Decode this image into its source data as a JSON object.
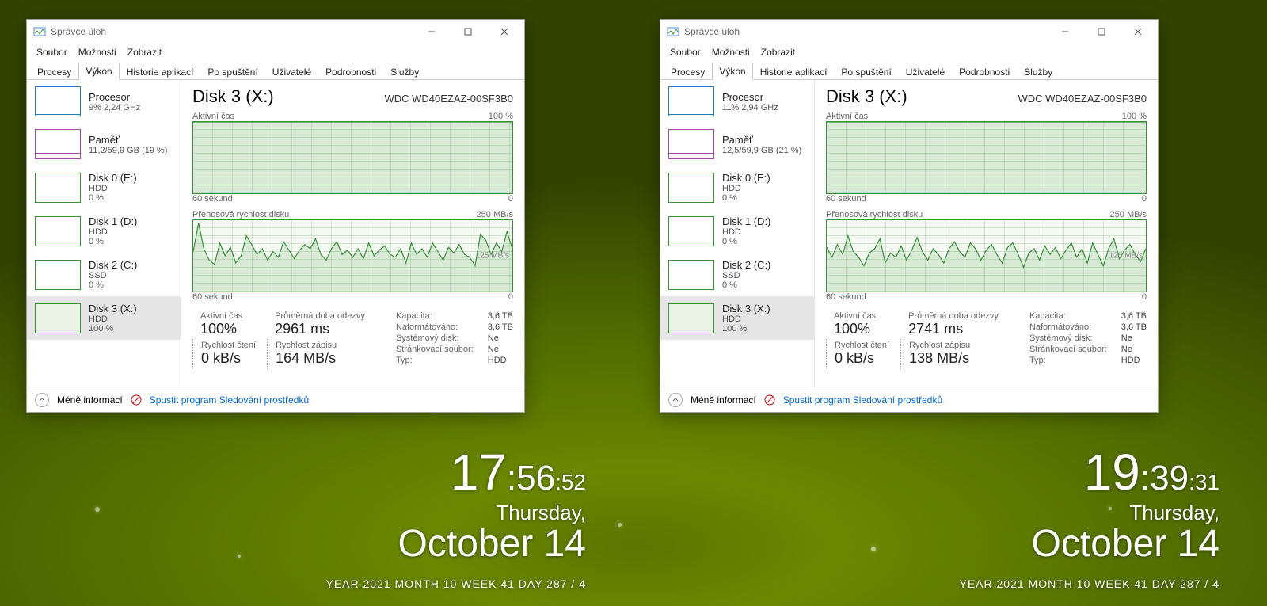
{
  "window_title": "Správce úloh",
  "menubar": [
    "Soubor",
    "Možnosti",
    "Zobrazit"
  ],
  "tabs": [
    "Procesy",
    "Výkon",
    "Historie aplikací",
    "Po spuštění",
    "Uživatelé",
    "Podrobnosti",
    "Služby"
  ],
  "selected_tab": "Výkon",
  "footer": {
    "less": "Méně informací",
    "resmon": "Spustit program Sledování prostředků"
  },
  "panel_common": {
    "disk_title": "Disk 3 (X:)",
    "disk_model": "WDC WD40EZAZ-00SF3B0",
    "g1_title": "Aktivní čas",
    "g1_max": "100 %",
    "g2_title": "Přenosová rychlost disku",
    "g2_max": "250 MB/s",
    "g2_mid": "125 MB/s",
    "x_left": "60 sekund",
    "x_right": "0",
    "lab_active": "Aktivní čas",
    "lab_resp": "Průměrná doba odezvy",
    "lab_read": "Rychlost čtení",
    "lab_write": "Rychlost zápisu",
    "props": {
      "k_cap": "Kapacita:",
      "k_fmt": "Naformátováno:",
      "k_sys": "Systémový disk:",
      "k_page": "Stránkovací soubor:",
      "k_type": "Typ:",
      "v_cap": "3,6 TB",
      "v_fmt": "3,6 TB",
      "v_sys": "Ne",
      "v_page": "Ne",
      "v_type": "HDD"
    }
  },
  "sidebar_common": {
    "cpu_title": "Procesor",
    "mem_title": "Paměť",
    "d0_title": "Disk 0 (E:)",
    "d0_sub": "HDD",
    "d0_pct": "0 %",
    "d1_title": "Disk 1 (D:)",
    "d1_sub": "HDD",
    "d1_pct": "0 %",
    "d2_title": "Disk 2 (C:)",
    "d2_sub": "SSD",
    "d2_pct": "0 %",
    "d3_title": "Disk 3 (X:)",
    "d3_sub": "HDD",
    "d3_pct": "100 %"
  },
  "panels": [
    {
      "cpu_sub": "9% 2,24 GHz",
      "mem_sub": "11,2/59,9 GB (19 %)",
      "active": "100%",
      "resp": "2961 ms",
      "read": "0 kB/s",
      "write": "164 MB/s",
      "clock": {
        "h": "17",
        "m": "56",
        "s": "52",
        "dow": "Thursday,",
        "mon": "October",
        "day": "14",
        "meta": "YEAR 2021      MONTH 10      WEEK 41      DAY 287   / 4"
      },
      "chart_data": [
        {
          "type": "line",
          "title": "Aktivní čas",
          "ylabel": "%",
          "ylim": [
            0,
            100
          ],
          "xlim_seconds": [
            60,
            0
          ],
          "values": [
            100,
            100,
            100,
            100,
            100,
            100,
            100,
            100,
            100,
            100,
            100,
            100,
            100,
            100,
            100,
            100,
            100,
            100,
            100,
            100,
            100,
            100,
            100,
            100,
            100,
            100,
            100,
            100,
            100,
            100,
            100,
            100,
            100,
            100,
            100,
            100,
            100,
            100,
            100,
            100,
            100,
            100,
            100,
            100,
            100,
            100,
            100,
            100,
            100,
            100,
            100,
            100,
            100,
            100,
            100,
            100,
            100,
            100,
            100,
            100,
            100
          ]
        },
        {
          "type": "line",
          "title": "Přenosová rychlost disku",
          "ylabel": "MB/s",
          "ylim": [
            0,
            250
          ],
          "xlim_seconds": [
            60,
            0
          ],
          "values": [
            140,
            240,
            150,
            110,
            95,
            170,
            125,
            155,
            100,
            125,
            195,
            165,
            130,
            150,
            110,
            140,
            120,
            175,
            145,
            115,
            145,
            165,
            150,
            185,
            130,
            110,
            150,
            175,
            130,
            145,
            120,
            150,
            115,
            170,
            125,
            145,
            160,
            130,
            120,
            150,
            100,
            170,
            130,
            150,
            120,
            170,
            140,
            110,
            155,
            135,
            165,
            130,
            120,
            90,
            200,
            180,
            130,
            170,
            140,
            210,
            150
          ]
        }
      ]
    },
    {
      "cpu_sub": "11% 2,94 GHz",
      "mem_sub": "12,5/59,9 GB (21 %)",
      "active": "100%",
      "resp": "2741 ms",
      "read": "0 kB/s",
      "write": "138 MB/s",
      "clock": {
        "h": "19",
        "m": "39",
        "s": "31",
        "dow": "Thursday,",
        "mon": "October",
        "day": "14",
        "meta": "YEAR 2021      MONTH 10      WEEK 41      DAY 287   / 4"
      },
      "chart_data": [
        {
          "type": "line",
          "title": "Aktivní čas",
          "ylabel": "%",
          "ylim": [
            0,
            100
          ],
          "xlim_seconds": [
            60,
            0
          ],
          "values": [
            100,
            100,
            100,
            100,
            100,
            100,
            100,
            100,
            100,
            100,
            100,
            100,
            100,
            100,
            100,
            100,
            100,
            100,
            100,
            100,
            100,
            100,
            100,
            100,
            100,
            100,
            100,
            100,
            100,
            100,
            100,
            100,
            100,
            100,
            100,
            100,
            100,
            100,
            100,
            100,
            100,
            100,
            100,
            100,
            100,
            100,
            100,
            100,
            100,
            100,
            100,
            100,
            100,
            100,
            100,
            100,
            100,
            100,
            100,
            100,
            100
          ]
        },
        {
          "type": "line",
          "title": "Přenosová rychlost disku",
          "ylabel": "MB/s",
          "ylim": [
            0,
            250
          ],
          "xlim_seconds": [
            60,
            0
          ],
          "values": [
            155,
            120,
            165,
            130,
            195,
            140,
            120,
            90,
            135,
            150,
            185,
            100,
            135,
            120,
            160,
            110,
            145,
            190,
            140,
            110,
            150,
            130,
            100,
            150,
            175,
            140,
            120,
            170,
            150,
            110,
            145,
            165,
            130,
            100,
            155,
            170,
            130,
            85,
            135,
            150,
            110,
            160,
            130,
            155,
            115,
            145,
            170,
            120,
            150,
            100,
            170,
            130,
            90,
            150,
            185,
            115,
            145,
            165,
            130,
            105,
            150
          ]
        }
      ]
    }
  ]
}
